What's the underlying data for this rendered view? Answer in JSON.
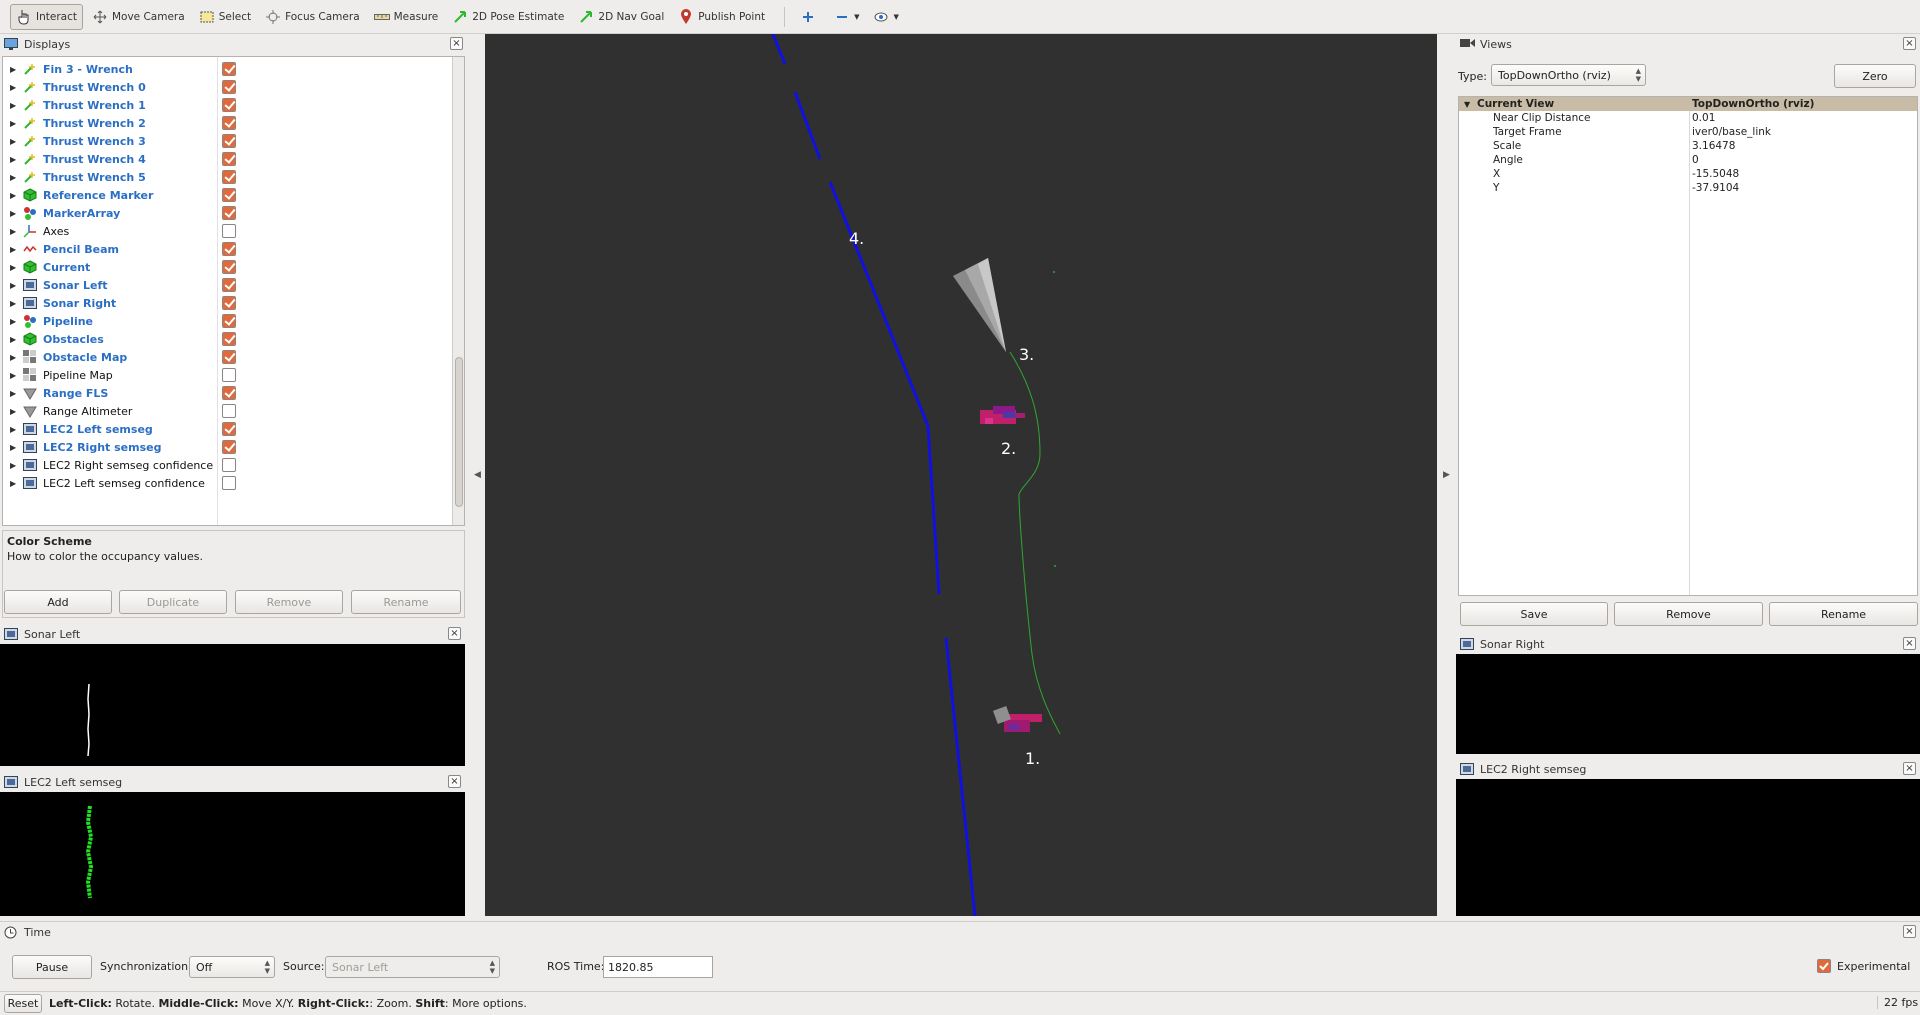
{
  "toolbar": {
    "tools": [
      {
        "label": "Interact",
        "icon": "hand-pointer-icon"
      },
      {
        "label": "Move Camera",
        "icon": "move-arrows-icon"
      },
      {
        "label": "Select",
        "icon": "select-box-icon"
      },
      {
        "label": "Focus Camera",
        "icon": "focus-crosshair-icon"
      },
      {
        "label": "Measure",
        "icon": "ruler-icon"
      },
      {
        "label": "2D Pose Estimate",
        "icon": "green-arrow-icon"
      },
      {
        "label": "2D Nav Goal",
        "icon": "green-arrow-icon"
      },
      {
        "label": "Publish Point",
        "icon": "map-pin-icon"
      }
    ],
    "active_tool": "Interact",
    "colors": {
      "pin": "#c0392b",
      "arrow": "#2db82d",
      "plus": "#2a6fc4"
    }
  },
  "displays": {
    "title": "Displays",
    "items": [
      {
        "label": "Fin 3 - Wrench",
        "enabled": true,
        "icon": "wrench-display-icon"
      },
      {
        "label": "Thrust Wrench 0",
        "enabled": true,
        "icon": "wrench-display-icon"
      },
      {
        "label": "Thrust Wrench 1",
        "enabled": true,
        "icon": "wrench-display-icon"
      },
      {
        "label": "Thrust Wrench 2",
        "enabled": true,
        "icon": "wrench-display-icon"
      },
      {
        "label": "Thrust Wrench 3",
        "enabled": true,
        "icon": "wrench-display-icon"
      },
      {
        "label": "Thrust Wrench 4",
        "enabled": true,
        "icon": "wrench-display-icon"
      },
      {
        "label": "Thrust Wrench 5",
        "enabled": true,
        "icon": "wrench-display-icon"
      },
      {
        "label": "Reference Marker",
        "enabled": true,
        "icon": "green-cube-icon"
      },
      {
        "label": "MarkerArray",
        "enabled": true,
        "icon": "marker-array-icon"
      },
      {
        "label": "Axes",
        "enabled": false,
        "icon": "axes-icon"
      },
      {
        "label": "Pencil Beam",
        "enabled": true,
        "icon": "pencil-beam-icon"
      },
      {
        "label": "Current",
        "enabled": true,
        "icon": "green-cube-icon"
      },
      {
        "label": "Sonar Left",
        "enabled": true,
        "icon": "image-display-icon"
      },
      {
        "label": "Sonar Right",
        "enabled": true,
        "icon": "image-display-icon"
      },
      {
        "label": "Pipeline",
        "enabled": true,
        "icon": "marker-array-icon"
      },
      {
        "label": "Obstacles",
        "enabled": true,
        "icon": "green-cube-icon"
      },
      {
        "label": "Obstacle Map",
        "enabled": true,
        "icon": "grid-map-icon"
      },
      {
        "label": "Pipeline Map",
        "enabled": false,
        "icon": "grid-map-icon"
      },
      {
        "label": "Range FLS",
        "enabled": true,
        "icon": "range-cone-icon"
      },
      {
        "label": "Range Altimeter",
        "enabled": false,
        "icon": "range-cone-icon"
      },
      {
        "label": "LEC2 Left semseg",
        "enabled": true,
        "icon": "image-display-icon"
      },
      {
        "label": "LEC2 Right semseg",
        "enabled": true,
        "icon": "image-display-icon"
      },
      {
        "label": "LEC2 Right semseg confidence",
        "enabled": false,
        "icon": "image-display-icon"
      },
      {
        "label": "LEC2 Left semseg confidence",
        "enabled": false,
        "icon": "image-display-icon"
      }
    ],
    "description_title": "Color Scheme",
    "description_text": "How to color the occupancy values.",
    "buttons": {
      "add": "Add",
      "duplicate": "Duplicate",
      "remove": "Remove",
      "rename": "Rename"
    }
  },
  "sonar_left_panel": {
    "title": "Sonar Left"
  },
  "lec2_left_panel": {
    "title": "LEC2 Left semseg"
  },
  "viewport": {
    "background": "#303030",
    "labels": [
      "1.",
      "2.",
      "3.",
      "4."
    ],
    "colors": {
      "pipeline": "#1010e0",
      "path": "#2fa82f",
      "obstacle": "#c0206a"
    }
  },
  "views": {
    "title": "Views",
    "type_label": "Type:",
    "type_value": "TopDownOrtho (rviz)",
    "zero_button": "Zero",
    "rows": [
      {
        "key": "Current View",
        "value": "TopDownOrtho (rviz)"
      },
      {
        "key": "Near Clip Distance",
        "value": "0.01"
      },
      {
        "key": "Target Frame",
        "value": "iver0/base_link"
      },
      {
        "key": "Scale",
        "value": "3.16478"
      },
      {
        "key": "Angle",
        "value": "0"
      },
      {
        "key": "X",
        "value": "-15.5048"
      },
      {
        "key": "Y",
        "value": "-37.9104"
      }
    ],
    "buttons": {
      "save": "Save",
      "remove": "Remove",
      "rename": "Rename"
    }
  },
  "sonar_right_panel": {
    "title": "Sonar Right"
  },
  "lec2_right_panel": {
    "title": "LEC2 Right semseg"
  },
  "time": {
    "title": "Time",
    "pause": "Pause",
    "sync_label": "Synchronization:",
    "sync_value": "Off",
    "source_label": "Source:",
    "source_value": "Sonar Left",
    "ros_time_label": "ROS Time:",
    "ros_time_value": "1820.85",
    "experimental": "Experimental",
    "experimental_checked": true
  },
  "status": {
    "reset": "Reset",
    "hint_b1": "Left-Click:",
    "hint_t1": " Rotate. ",
    "hint_b2": "Middle-Click:",
    "hint_t2": " Move X/Y. ",
    "hint_b3": "Right-Click:",
    "hint_t3": ": Zoom. ",
    "hint_b4": "Shift",
    "hint_t4": ": More options.",
    "fps": "22 fps"
  }
}
